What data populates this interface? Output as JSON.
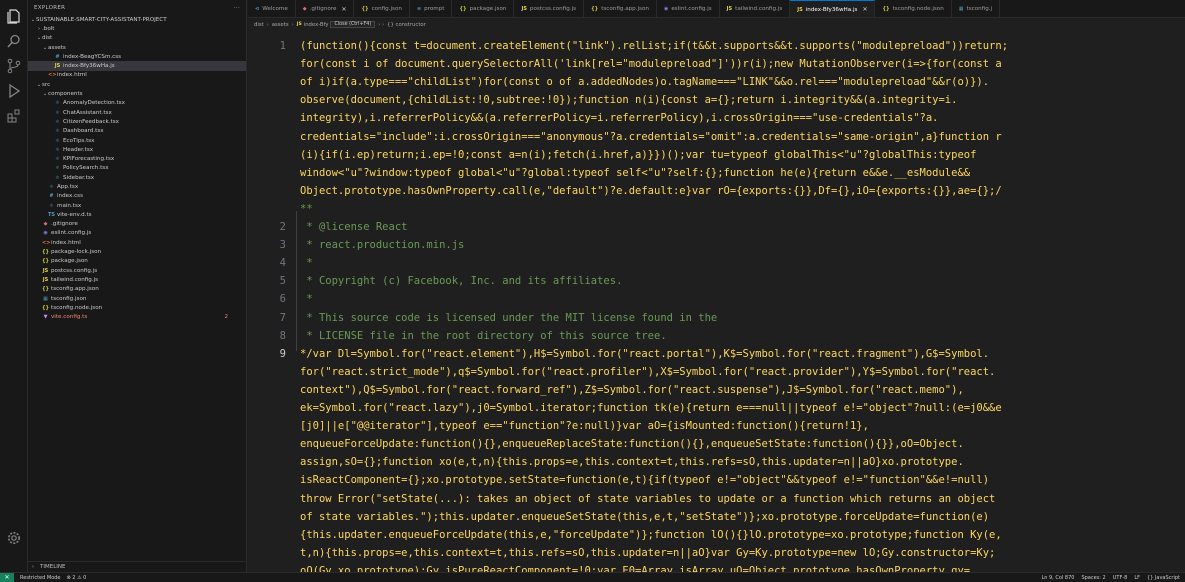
{
  "sidebar": {
    "header_title": "EXPLORER",
    "header_more": "···",
    "tree": [
      {
        "indent": 0,
        "chev": "⌄",
        "icon": "",
        "icon_class": "",
        "label": "SUSTAINABLE-SMART-CITY-ASSISTANT-PROJECT",
        "selected": false,
        "badge": ""
      },
      {
        "indent": 1,
        "chev": "›",
        "icon": "",
        "icon_class": "",
        "label": ".bolt",
        "selected": false,
        "badge": ""
      },
      {
        "indent": 1,
        "chev": "⌄",
        "icon": "",
        "icon_class": "",
        "label": "dist",
        "selected": false,
        "badge": ""
      },
      {
        "indent": 2,
        "chev": "⌄",
        "icon": "",
        "icon_class": "",
        "label": "assets",
        "selected": false,
        "badge": ""
      },
      {
        "indent": 3,
        "chev": "",
        "icon": "#",
        "icon_class": "c-css",
        "label": "index-BeagYCSm.css",
        "selected": false,
        "badge": ""
      },
      {
        "indent": 3,
        "chev": "",
        "icon": "JS",
        "icon_class": "c-js",
        "label": "index-Bfy36wHa.js",
        "selected": true,
        "badge": ""
      },
      {
        "indent": 2,
        "chev": "",
        "icon": "<>",
        "icon_class": "c-html",
        "label": "index.html",
        "selected": false,
        "badge": ""
      },
      {
        "indent": 1,
        "chev": "⌄",
        "icon": "",
        "icon_class": "",
        "label": "src",
        "selected": false,
        "badge": ""
      },
      {
        "indent": 2,
        "chev": "⌄",
        "icon": "",
        "icon_class": "",
        "label": "components",
        "selected": false,
        "badge": ""
      },
      {
        "indent": 3,
        "chev": "",
        "icon": "⚛",
        "icon_class": "c-tsx",
        "label": "AnomalyDetection.tsx",
        "selected": false,
        "badge": ""
      },
      {
        "indent": 3,
        "chev": "",
        "icon": "⚛",
        "icon_class": "c-tsx",
        "label": "ChatAssistant.tsx",
        "selected": false,
        "badge": ""
      },
      {
        "indent": 3,
        "chev": "",
        "icon": "⚛",
        "icon_class": "c-tsx",
        "label": "CitizenFeedback.tsx",
        "selected": false,
        "badge": ""
      },
      {
        "indent": 3,
        "chev": "",
        "icon": "⚛",
        "icon_class": "c-tsx",
        "label": "Dashboard.tsx",
        "selected": false,
        "badge": ""
      },
      {
        "indent": 3,
        "chev": "",
        "icon": "⚛",
        "icon_class": "c-tsx",
        "label": "EcoTips.tsx",
        "selected": false,
        "badge": ""
      },
      {
        "indent": 3,
        "chev": "",
        "icon": "⚛",
        "icon_class": "c-tsx",
        "label": "Header.tsx",
        "selected": false,
        "badge": ""
      },
      {
        "indent": 3,
        "chev": "",
        "icon": "⚛",
        "icon_class": "c-tsx",
        "label": "KPIForecasting.tsx",
        "selected": false,
        "badge": ""
      },
      {
        "indent": 3,
        "chev": "",
        "icon": "⚛",
        "icon_class": "c-tsx",
        "label": "PolicySearch.tsx",
        "selected": false,
        "badge": ""
      },
      {
        "indent": 3,
        "chev": "",
        "icon": "⚛",
        "icon_class": "c-tsx",
        "label": "Sidebar.tsx",
        "selected": false,
        "badge": ""
      },
      {
        "indent": 2,
        "chev": "",
        "icon": "⚛",
        "icon_class": "c-tsx",
        "label": "App.tsx",
        "selected": false,
        "badge": ""
      },
      {
        "indent": 2,
        "chev": "",
        "icon": "#",
        "icon_class": "c-css",
        "label": "index.css",
        "selected": false,
        "badge": ""
      },
      {
        "indent": 2,
        "chev": "",
        "icon": "⚛",
        "icon_class": "c-tsx",
        "label": "main.tsx",
        "selected": false,
        "badge": ""
      },
      {
        "indent": 2,
        "chev": "",
        "icon": "TS",
        "icon_class": "c-ts",
        "label": "vite-env.d.ts",
        "selected": false,
        "badge": ""
      },
      {
        "indent": 1,
        "chev": "",
        "icon": "◆",
        "icon_class": "c-git",
        "label": ".gitignore",
        "selected": false,
        "badge": ""
      },
      {
        "indent": 1,
        "chev": "",
        "icon": "◉",
        "icon_class": "c-eslint",
        "label": "eslint.config.js",
        "selected": false,
        "badge": ""
      },
      {
        "indent": 1,
        "chev": "",
        "icon": "<>",
        "icon_class": "c-html",
        "label": "index.html",
        "selected": false,
        "badge": ""
      },
      {
        "indent": 1,
        "chev": "",
        "icon": "{}",
        "icon_class": "c-json",
        "label": "package-lock.json",
        "selected": false,
        "badge": ""
      },
      {
        "indent": 1,
        "chev": "",
        "icon": "{}",
        "icon_class": "c-json",
        "label": "package.json",
        "selected": false,
        "badge": ""
      },
      {
        "indent": 1,
        "chev": "",
        "icon": "JS",
        "icon_class": "c-js",
        "label": "postcss.config.js",
        "selected": false,
        "badge": ""
      },
      {
        "indent": 1,
        "chev": "",
        "icon": "JS",
        "icon_class": "c-js",
        "label": "tailwind.config.js",
        "selected": false,
        "badge": ""
      },
      {
        "indent": 1,
        "chev": "",
        "icon": "{}",
        "icon_class": "c-json",
        "label": "tsconfig.app.json",
        "selected": false,
        "badge": ""
      },
      {
        "indent": 1,
        "chev": "",
        "icon": "▦",
        "icon_class": "c-ts",
        "label": "tsconfig.json",
        "selected": false,
        "badge": ""
      },
      {
        "indent": 1,
        "chev": "",
        "icon": "{}",
        "icon_class": "c-json",
        "label": "tsconfig.node.json",
        "selected": false,
        "badge": ""
      },
      {
        "indent": 1,
        "chev": "",
        "icon": "▼",
        "icon_class": "c-vite",
        "label": "vite.config.ts",
        "selected": false,
        "badge": "2"
      }
    ],
    "timeline_label": "TIMELINE"
  },
  "tabs": [
    {
      "icon": "⊲",
      "icon_class": "c-ts",
      "label": "Welcome",
      "active": false
    },
    {
      "icon": "◆",
      "icon_class": "c-git",
      "label": ".gitignore",
      "active": false,
      "close": "✕"
    },
    {
      "icon": "{}",
      "icon_class": "c-json",
      "label": "config.json",
      "active": false
    },
    {
      "icon": "≡",
      "icon_class": "c-ts",
      "label": "prompt",
      "active": false
    },
    {
      "icon": "{}",
      "icon_class": "c-json",
      "label": "package.json",
      "active": false
    },
    {
      "icon": "JS",
      "icon_class": "c-js",
      "label": "postcss.config.js",
      "active": false
    },
    {
      "icon": "{}",
      "icon_class": "c-json",
      "label": "tsconfig.app.json",
      "active": false
    },
    {
      "icon": "◉",
      "icon_class": "c-eslint",
      "label": "eslint.config.js",
      "active": false
    },
    {
      "icon": "JS",
      "icon_class": "c-js",
      "label": "tailwind.config.js",
      "active": false
    },
    {
      "icon": "JS",
      "icon_class": "c-js",
      "label": "index-Bfy36wHa.js",
      "active": true,
      "close": "✕"
    },
    {
      "icon": "{}",
      "icon_class": "c-json",
      "label": "tsconfig.node.json",
      "active": false
    },
    {
      "icon": "▦",
      "icon_class": "c-ts",
      "label": "tsconfig.j",
      "active": false
    }
  ],
  "breadcrumb": {
    "parts": [
      "dist",
      "assets",
      "index-Bfy",
      "{} constructor"
    ],
    "tooltip": "Close (Ctrl+F4)",
    "file_icon": "JS"
  },
  "editor": {
    "lines": [
      {
        "num": "1",
        "kind": "code-line",
        "text": "(function(){const t=document.createElement(\"link\").relList;if(t&&t.supports&&t.supports(\"modulepreload\"))return;"
      },
      {
        "num": "",
        "kind": "code-line",
        "text": "for(const i of document.querySelectorAll('link[rel=\"modulepreload\"]'))r(i);new MutationObserver(i=>{for(const a"
      },
      {
        "num": "",
        "kind": "code-line",
        "text": "of i)if(a.type===\"childList\")for(const o of a.addedNodes)o.tagName===\"LINK\"&&o.rel===\"modulepreload\"&&r(o)})."
      },
      {
        "num": "",
        "kind": "code-line",
        "text": "observe(document,{childList:!0,subtree:!0});function n(i){const a={};return i.integrity&&(a.integrity=i."
      },
      {
        "num": "",
        "kind": "code-line",
        "text": "integrity),i.referrerPolicy&&(a.referrerPolicy=i.referrerPolicy),i.crossOrigin===\"use-credentials\"?a."
      },
      {
        "num": "",
        "kind": "code-line",
        "text": "credentials=\"include\":i.crossOrigin===\"anonymous\"?a.credentials=\"omit\":a.credentials=\"same-origin\",a}function r"
      },
      {
        "num": "",
        "kind": "code-line",
        "text": "(i){if(i.ep)return;i.ep=!0;const a=n(i);fetch(i.href,a)}})();var tu=typeof globalThis<\"u\"?globalThis:typeof"
      },
      {
        "num": "",
        "kind": "code-line",
        "text": "window<\"u\"?window:typeof global<\"u\"?global:typeof self<\"u\"?self:{};function he(e){return e&&e.__esModule&&"
      },
      {
        "num": "",
        "kind": "code-line",
        "text": "Object.prototype.hasOwnProperty.call(e,\"default\")?e.default:e}var rO={exports:{}},Df={},iO={exports:{}},ae={};/"
      },
      {
        "num": "",
        "kind": "comment",
        "text": "**"
      },
      {
        "num": "2",
        "kind": "comment",
        "text": " * @license React"
      },
      {
        "num": "3",
        "kind": "comment",
        "text": " * react.production.min.js"
      },
      {
        "num": "4",
        "kind": "comment",
        "text": " *"
      },
      {
        "num": "5",
        "kind": "comment",
        "text": " * Copyright (c) Facebook, Inc. and its affiliates."
      },
      {
        "num": "6",
        "kind": "comment",
        "text": " *"
      },
      {
        "num": "7",
        "kind": "comment",
        "text": " * This source code is licensed under the MIT license found in the"
      },
      {
        "num": "8",
        "kind": "comment",
        "text": " * LICENSE file in the root directory of this source tree."
      },
      {
        "num": "9",
        "kind": "code-line",
        "text": "*/var Dl=Symbol.for(\"react.element\"),H$=Symbol.for(\"react.portal\"),K$=Symbol.for(\"react.fragment\"),G$=Symbol."
      },
      {
        "num": "",
        "kind": "code-line",
        "text": "for(\"react.strict_mode\"),q$=Symbol.for(\"react.profiler\"),X$=Symbol.for(\"react.provider\"),Y$=Symbol.for(\"react."
      },
      {
        "num": "",
        "kind": "code-line",
        "text": "context\"),Q$=Symbol.for(\"react.forward_ref\"),Z$=Symbol.for(\"react.suspense\"),J$=Symbol.for(\"react.memo\"),"
      },
      {
        "num": "",
        "kind": "code-line",
        "text": "ek=Symbol.for(\"react.lazy\"),j0=Symbol.iterator;function tk(e){return e===null||typeof e!=\"object\"?null:(e=j0&&e"
      },
      {
        "num": "",
        "kind": "code-line",
        "text": "[j0]||e[\"@@iterator\"],typeof e==\"function\"?e:null)}var aO={isMounted:function(){return!1},"
      },
      {
        "num": "",
        "kind": "code-line",
        "text": "enqueueForceUpdate:function(){},enqueueReplaceState:function(){},enqueueSetState:function(){}},oO=Object."
      },
      {
        "num": "",
        "kind": "code-line",
        "text": "assign,sO={};function xo(e,t,n){this.props=e,this.context=t,this.refs=sO,this.updater=n||aO}xo.prototype."
      },
      {
        "num": "",
        "kind": "code-line",
        "text": "isReactComponent={};xo.prototype.setState=function(e,t){if(typeof e!=\"object\"&&typeof e!=\"function\"&&e!=null)"
      },
      {
        "num": "",
        "kind": "code-line",
        "text": "throw Error(\"setState(...): takes an object of state variables to update or a function which returns an object"
      },
      {
        "num": "",
        "kind": "code-line",
        "text": "of state variables.\");this.updater.enqueueSetState(this,e,t,\"setState\")};xo.prototype.forceUpdate=function(e)"
      },
      {
        "num": "",
        "kind": "code-line",
        "text": "{this.updater.enqueueForceUpdate(this,e,\"forceUpdate\")};function lO(){}lO.prototype=xo.prototype;function Ky(e,"
      },
      {
        "num": "",
        "kind": "code-line",
        "text": "t,n){this.props=e,this.context=t,this.refs=sO,this.updater=n||aO}var Gy=Ky.prototype=new lO;Gy.constructor=Ky;"
      },
      {
        "num": "",
        "kind": "code-line",
        "text": "oO(Gy,xo.prototype);Gy.isPureReactComponent=!0;var E0=Array.isArray,uO=Object.prototype.hasOwnProperty,qy="
      }
    ]
  },
  "status": {
    "remote": "✕",
    "mode": "Restricted Mode",
    "problems": "⊗ 2 ⚠ 0",
    "right": [
      "Ln 9, Col 870",
      "Spaces: 2",
      "UTF-8",
      "LF",
      "{} JavaScript"
    ]
  }
}
